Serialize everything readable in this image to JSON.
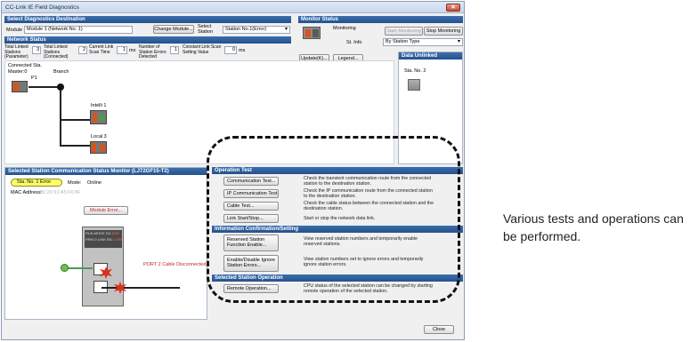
{
  "window": {
    "title": "CC-Link IE Field Diagnostics",
    "close_glyph": "✕"
  },
  "destination": {
    "header": "Select Diagnostics Destination",
    "module_label": "Module",
    "module_value": "Module 1 (Network No. 1)",
    "change_module_btn": "Change Module...",
    "select_station_label": "Select Station",
    "station_value": "Station No.1(Error)"
  },
  "monitor_status": {
    "header": "Monitor Status",
    "monitoring_text": "Monitoring",
    "start_btn": "Start Monitoring",
    "stop_btn": "Stop Monitoring",
    "st_info_label": "St. Info",
    "st_info_value": "By Station Type"
  },
  "network_status": {
    "header": "Network Status",
    "total_param_label": "Total Linked Stations (Parameter)",
    "total_param_value": "3",
    "total_conn_label": "Total Linked Stations (Connected)",
    "total_conn_value": "2",
    "scan_label": "Current Link Scan Time",
    "scan_value": "1",
    "scan_unit": "ms",
    "errors_label": "Number of Station Errors Detected",
    "errors_value": "1",
    "const_label": "Constant Link Scan Setting Value",
    "const_value": "0",
    "const_unit": "ms",
    "update_btn": "Update(K)...",
    "legend_btn": "Legend..."
  },
  "data_unlinked": {
    "header": "Data Unlinked",
    "station": "Sta. No. 2"
  },
  "topology": {
    "connected_sta_label": "Connected Sta.",
    "master_label": "Master:0",
    "branch_label": "Branch",
    "p1_label": "P1",
    "intelli_label": "Intelli 1",
    "local_label": "Local 3"
  },
  "comm_monitor": {
    "header": "Selected Station Communication Status Monitor (LJ72GF15-T2)",
    "station_badge": "Sta. No. 1",
    "station_state": "Error",
    "mode_label": "Mode:",
    "mode_value": "Online",
    "mac_label": "MAC Address:",
    "mac_value": "00:26:92:A5:F6:8F",
    "module_error_btn": "Module Error...",
    "port2_text": "PORT 2 Cable Disconnected...",
    "led_row1": [
      "RUN",
      "MODE",
      "SD",
      "ERR"
    ],
    "led_row2": [
      "PRM",
      "D LINK",
      "RD",
      "L ERR"
    ]
  },
  "operation_test": {
    "header": "Operation Test",
    "items": [
      {
        "btn": "Communication Test...",
        "desc": "Check the transient communication route from the connected station to the destination station."
      },
      {
        "btn": "IP Communication Test...",
        "desc": "Check the IP communication route from the connected station to the destination station."
      },
      {
        "btn": "Cable Test...",
        "desc": "Check the cable status between the connected station and the destination station."
      },
      {
        "btn": "Link Start/Stop...",
        "desc": "Start or stop the network data link."
      }
    ]
  },
  "info_confirm": {
    "header": "Information Confirmation/Setting",
    "items": [
      {
        "btn": "Reserved Station Function Enable...",
        "desc": "View reserved station numbers and temporarily enable reserved stations."
      },
      {
        "btn": "Enable/Disable Ignore Station Errors...",
        "desc": "View station numbers set to ignore errors and temporarily ignore station errors."
      }
    ]
  },
  "selected_op": {
    "header": "Selected Station Operation",
    "items": [
      {
        "btn": "Remote Operation...",
        "desc": "CPU status of the selected station can be changed by starting remote operation of the selected station."
      }
    ]
  },
  "footer": {
    "close_btn": "Close"
  },
  "annotation": "Various tests and operations can be performed."
}
